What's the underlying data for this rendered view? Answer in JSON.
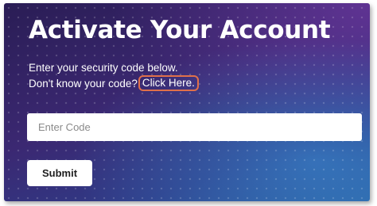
{
  "header": {
    "title": "Activate Your Account"
  },
  "instructions": {
    "line1": "Enter your security code below.",
    "line2_text": "Don't know your code?",
    "link_label": "Click Here."
  },
  "code_field": {
    "placeholder": "Enter Code",
    "value": ""
  },
  "submit": {
    "label": "Submit"
  },
  "colors": {
    "background_start": "#2a1d55",
    "background_end": "#2b5c9e",
    "link_highlight": "#e0704a",
    "text": "#ffffff"
  }
}
